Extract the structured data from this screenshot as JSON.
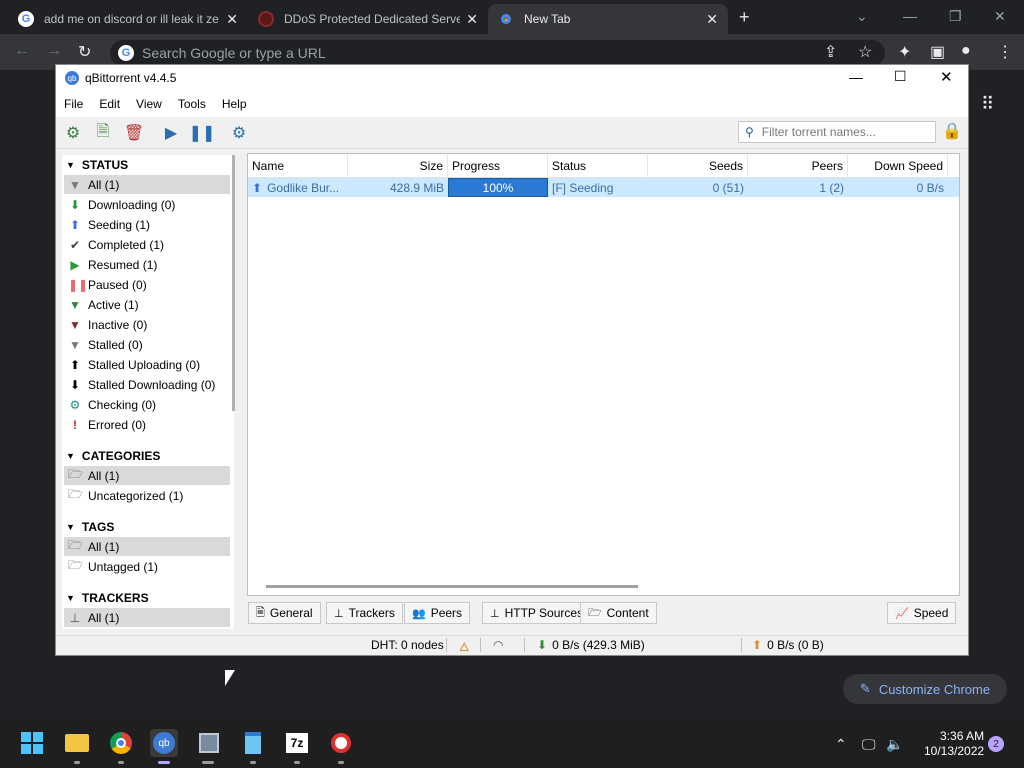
{
  "chrome": {
    "tabs": [
      {
        "title": "add me on discord or ill leak it ze",
        "icon": "google-g-icon"
      },
      {
        "title": "DDoS Protected Dedicated Serve",
        "icon": "dark-site-icon"
      },
      {
        "title": "New Tab",
        "icon": "chrome-icon"
      }
    ],
    "new_tab": "+",
    "omnibox_placeholder": "Search Google or type a URL",
    "customize_label": "Customize Chrome"
  },
  "qbt": {
    "title": "qBittorrent v4.4.5",
    "app_icon_text": "qb",
    "menu": [
      "File",
      "Edit",
      "View",
      "Tools",
      "Help"
    ],
    "filter_placeholder": "Filter torrent names...",
    "sections": {
      "status": "STATUS",
      "categories": "CATEGORIES",
      "tags": "TAGS",
      "trackers": "TRACKERS"
    },
    "status_items": [
      {
        "label": "All (1)"
      },
      {
        "label": "Downloading (0)"
      },
      {
        "label": "Seeding (1)"
      },
      {
        "label": "Completed (1)"
      },
      {
        "label": "Resumed (1)"
      },
      {
        "label": "Paused (0)"
      },
      {
        "label": "Active (1)"
      },
      {
        "label": "Inactive (0)"
      },
      {
        "label": "Stalled (0)"
      },
      {
        "label": "Stalled Uploading (0)"
      },
      {
        "label": "Stalled Downloading (0)"
      },
      {
        "label": "Checking (0)"
      },
      {
        "label": "Errored (0)"
      }
    ],
    "category_items": [
      {
        "label": "All (1)"
      },
      {
        "label": "Uncategorized (1)"
      }
    ],
    "tag_items": [
      {
        "label": "All (1)"
      },
      {
        "label": "Untagged (1)"
      }
    ],
    "tracker_items": [
      {
        "label": "All (1)"
      }
    ],
    "columns": [
      "Name",
      "Size",
      "Progress",
      "Status",
      "Seeds",
      "Peers",
      "Down Speed"
    ],
    "torrent": {
      "name": "Godlike Bur...",
      "size": "428.9 MiB",
      "progress_label": "100%",
      "progress": 1.0,
      "status": "[F] Seeding",
      "seeds": "0 (51)",
      "peers": "1 (2)",
      "down_speed": "0 B/s"
    },
    "bottom_tabs": [
      "General",
      "Trackers",
      "Peers",
      "HTTP Sources",
      "Content"
    ],
    "speed_button": "Speed",
    "statusbar": {
      "dht": "DHT: 0 nodes",
      "download": "0 B/s (429.3 MiB)",
      "upload": "0 B/s (0 B)"
    }
  },
  "taskbar": {
    "time": "3:36 AM",
    "date": "10/13/2022",
    "notifications": "2",
    "sevenzip_label": "7z"
  }
}
